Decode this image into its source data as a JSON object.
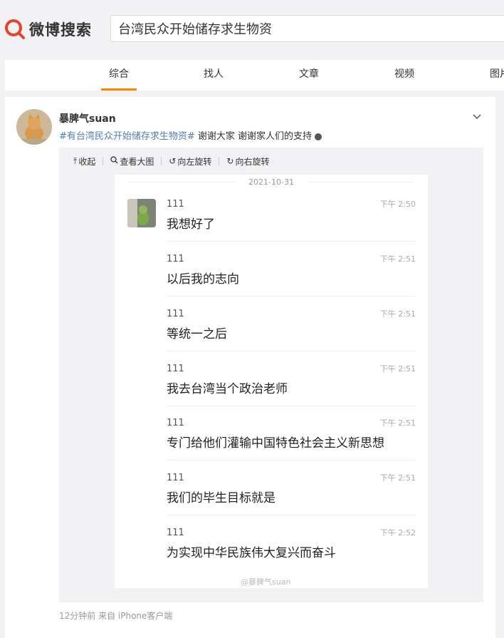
{
  "header": {
    "logo_text": "微博搜索",
    "search_value": "台湾民众开始储存求生物资"
  },
  "tabs": [
    {
      "label": "综合",
      "active": true
    },
    {
      "label": "找人",
      "active": false
    },
    {
      "label": "文章",
      "active": false
    },
    {
      "label": "视频",
      "active": false
    },
    {
      "label": "图片",
      "active": false
    }
  ],
  "post": {
    "username": "暴脾气suan",
    "hashtag": "#有台湾民众开始储存求生物资#",
    "text": " 谢谢大家 谢谢家人们的支持 ",
    "footer": "12分钟前  来自 iPhone客户端"
  },
  "toolbar": {
    "collapse": "收起",
    "view_large": "查看大图",
    "rotate_left": "向左旋转",
    "rotate_right": "向右旋转"
  },
  "chat": {
    "date": "2021-10-31",
    "messages": [
      {
        "name": "111",
        "time": "下午 2:50",
        "text": "我想好了"
      },
      {
        "name": "111",
        "time": "下午 2:51",
        "text": "以后我的志向"
      },
      {
        "name": "111",
        "time": "下午 2:51",
        "text": "等统一之后"
      },
      {
        "name": "111",
        "time": "下午 2:51",
        "text": "我去台湾当个政治老师"
      },
      {
        "name": "111",
        "time": "下午 2:51",
        "text": "专门给他们灌输中国特色社会主义新思想"
      },
      {
        "name": "111",
        "time": "下午 2:51",
        "text": "我们的毕生目标就是"
      },
      {
        "name": "111",
        "time": "下午 2:52",
        "text": "为实现中华民族伟大复兴而奋斗"
      }
    ],
    "watermark": "@暴脾气suan"
  },
  "colors": {
    "accent": "#ff8200",
    "link": "#507daf",
    "logo_red": "#e6432e"
  }
}
